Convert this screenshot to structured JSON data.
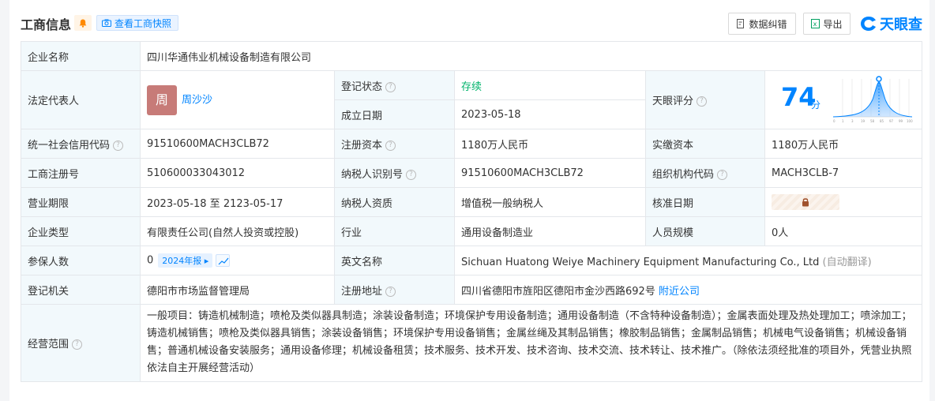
{
  "header": {
    "title": "工商信息",
    "snapshot_label": "查看工商快照",
    "correct_label": "数据纠错",
    "export_label": "导出",
    "logo_text": "天眼查"
  },
  "rows": {
    "company_name": {
      "label": "企业名称",
      "value": "四川华通伟业机械设备制造有限公司"
    },
    "legal_rep": {
      "label": "法定代表人",
      "avatar": "周",
      "name": "周沙沙"
    },
    "reg_status": {
      "label": "登记状态",
      "value": "存续"
    },
    "established": {
      "label": "成立日期",
      "value": "2023-05-18"
    },
    "score": {
      "label": "天眼评分",
      "value": "74",
      "unit": "分",
      "ticks": [
        "0",
        "1",
        "3",
        "19",
        "58",
        "85",
        "97",
        "99",
        "100"
      ]
    },
    "credit_code": {
      "label": "统一社会信用代码",
      "value": "91510600MACH3CLB72"
    },
    "reg_capital": {
      "label": "注册资本",
      "value": "1180万人民币"
    },
    "paid_capital": {
      "label": "实缴资本",
      "value": "1180万人民币"
    },
    "reg_no": {
      "label": "工商注册号",
      "value": "510600033043012"
    },
    "taxpayer_id": {
      "label": "纳税人识别号",
      "value": "91510600MACH3CLB72"
    },
    "org_code": {
      "label": "组织机构代码",
      "value": "MACH3CLB-7"
    },
    "term": {
      "label": "营业期限",
      "value": "2023-05-18 至 2123-05-17"
    },
    "taxpayer_type": {
      "label": "纳税人资质",
      "value": "增值税一般纳税人"
    },
    "approval_date": {
      "label": "核准日期"
    },
    "company_type": {
      "label": "企业类型",
      "value": "有限责任公司(自然人投资或控股)"
    },
    "industry": {
      "label": "行业",
      "value": "通用设备制造业"
    },
    "staff_size": {
      "label": "人员规模",
      "value": "0人"
    },
    "insured": {
      "label": "参保人数",
      "value": "0",
      "report": "2024年报"
    },
    "english_name": {
      "label": "英文名称",
      "value": "Sichuan Huatong Weiye Machinery Equipment Manufacturing Co., Ltd",
      "note": "(自动翻译)"
    },
    "authority": {
      "label": "登记机关",
      "value": "德阳市市场监督管理局"
    },
    "address": {
      "label": "注册地址",
      "value": "四川省德阳市旌阳区德阳市金沙西路692号",
      "link": "附近公司"
    },
    "scope": {
      "label": "经营范围",
      "value": "一般项目：铸造机械制造；喷枪及类似器具制造；涂装设备制造；环境保护专用设备制造；通用设备制造（不含特种设备制造）；金属表面处理及热处理加工；喷涂加工；铸造机械销售；喷枪及类似器具销售；涂装设备销售；环境保护专用设备销售；金属丝绳及其制品销售；橡胶制品销售；金属制品销售；机械电气设备销售；机械设备销售；普通机械设备安装服务；通用设备修理；机械设备租赁；技术服务、技术开发、技术咨询、技术交流、技术转让、技术推广。（除依法须经批准的项目外，凭营业执照依法自主开展经营活动）"
    }
  }
}
